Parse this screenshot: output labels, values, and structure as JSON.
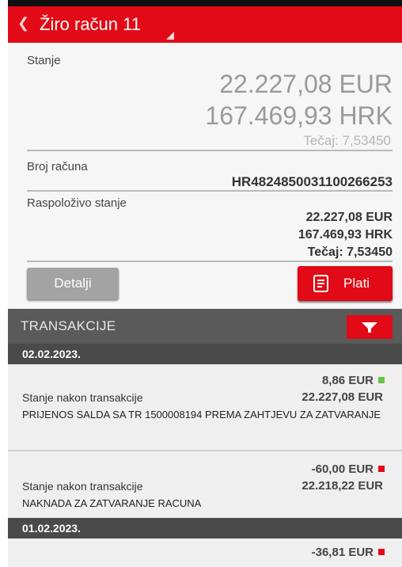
{
  "header": {
    "back_icon": "chevron-left-icon",
    "title": "Žiro račun 11"
  },
  "balance": {
    "label": "Stanje",
    "eur": "22.227,08 EUR",
    "hrk": "167.469,93 HRK",
    "rate": "Tečaj: 7,53450"
  },
  "account": {
    "label": "Broj računa",
    "number": "HR4824850031100266253"
  },
  "available": {
    "label": "Raspoloživo stanje",
    "eur": "22.227,08 EUR",
    "hrk": "167.469,93 HRK",
    "rate": "Tečaj: 7,53450"
  },
  "buttons": {
    "details": "Detalji",
    "pay": "Plati",
    "pay_icon": "document-pay-icon"
  },
  "transactions": {
    "title": "TRANSAKCIJE",
    "filter_icon": "filter-icon",
    "groups": [
      {
        "date": "02.02.2023.",
        "items": [
          {
            "amount": "8,86 EUR",
            "balance_label": "Stanje nakon transakcije",
            "balance": "22.227,08 EUR",
            "description": "PRIJENOS SALDA SA TR 1500008194 PREMA ZAHTJEVU ZA ZATVARANJE",
            "color": "#6cc24a"
          },
          {
            "amount": "-60,00 EUR",
            "balance_label": "Stanje nakon transakcije",
            "balance": "22.218,22 EUR",
            "description": "NAKNADA ZA ZATVARANJE RACUNA",
            "color": "#e20a16"
          }
        ]
      },
      {
        "date": "01.02.2023.",
        "items": [
          {
            "amount": "-36,81 EUR",
            "color": "#e20a16"
          }
        ]
      }
    ]
  },
  "colors": {
    "brand_red": "#e20a16",
    "dark_header": "#5a5a5a",
    "positive": "#6cc24a",
    "negative": "#e20a16"
  }
}
